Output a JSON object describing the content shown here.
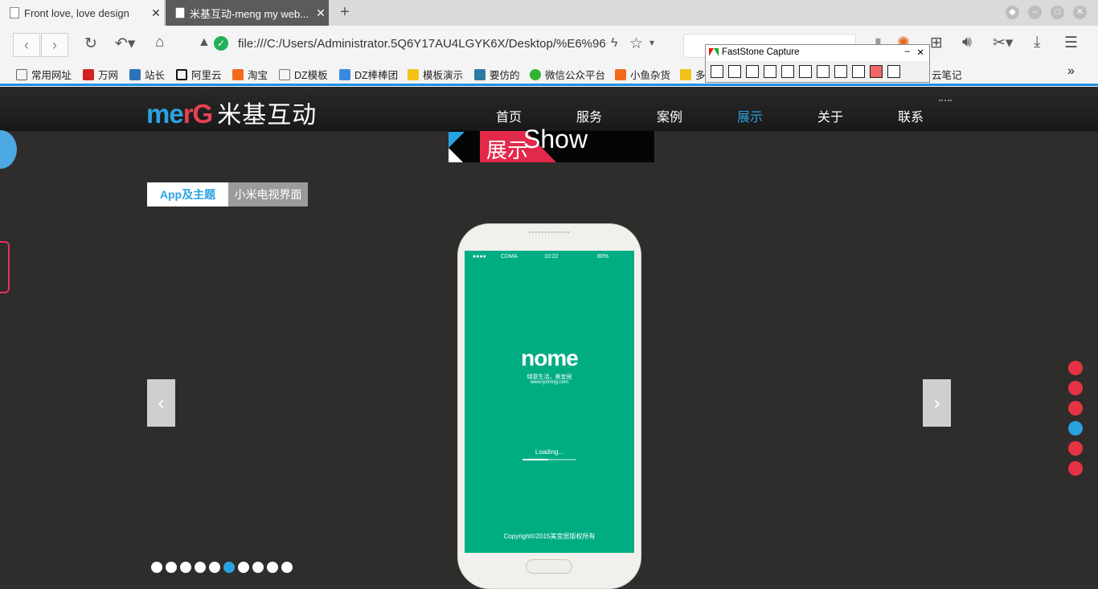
{
  "browser": {
    "tabs": [
      {
        "title": "Front love, love design",
        "active": false
      },
      {
        "title": "米基互动-meng my web...",
        "active": true
      }
    ],
    "new_tab": "+",
    "address": "file:///C:/Users/Administrator.5Q6Y17AU4LGYK6X/Desktop/%E6%96",
    "bookmarks": [
      "常用网址",
      "万网",
      "站长",
      "阿里云",
      "淘宝",
      "DZ模板",
      "DZ棒棒团",
      "模板演示",
      "要仿的",
      "微信公众平台",
      "小鱼杂货",
      "多",
      "云笔记"
    ],
    "more": "»"
  },
  "faststone": {
    "title": "FastStone Capture",
    "min": "–",
    "close": "✕"
  },
  "site": {
    "logo": {
      "en1": "me",
      "en2": "rG",
      "cn": "米基互动"
    },
    "nav": [
      {
        "label": "首页",
        "active": false
      },
      {
        "label": "服务",
        "active": false
      },
      {
        "label": "案例",
        "active": false
      },
      {
        "label": "展示",
        "active": true
      },
      {
        "label": "关于",
        "active": false
      },
      {
        "label": "联系",
        "active": false
      }
    ],
    "section": {
      "cn": "展示",
      "en": "Show"
    },
    "categories": [
      {
        "label": "App及主题",
        "active": true
      },
      {
        "label": "小米电视界面",
        "active": false
      }
    ],
    "phone": {
      "carrier": "CDMA",
      "time": "10:22",
      "battery": "80%",
      "brand": "nome",
      "tagline": "绿意生活，美宜居",
      "url": "www.lyshmyj.com",
      "loading": "Loading...",
      "copyright": "Copyright©2015美宜居版权所有"
    },
    "prev": "‹",
    "next": "›",
    "side_dots_active": 3,
    "slide_dots_active": 5
  },
  "colors": {
    "accent": "#2ba2e0",
    "red": "#e63344",
    "phone_screen": "#00ad83"
  }
}
